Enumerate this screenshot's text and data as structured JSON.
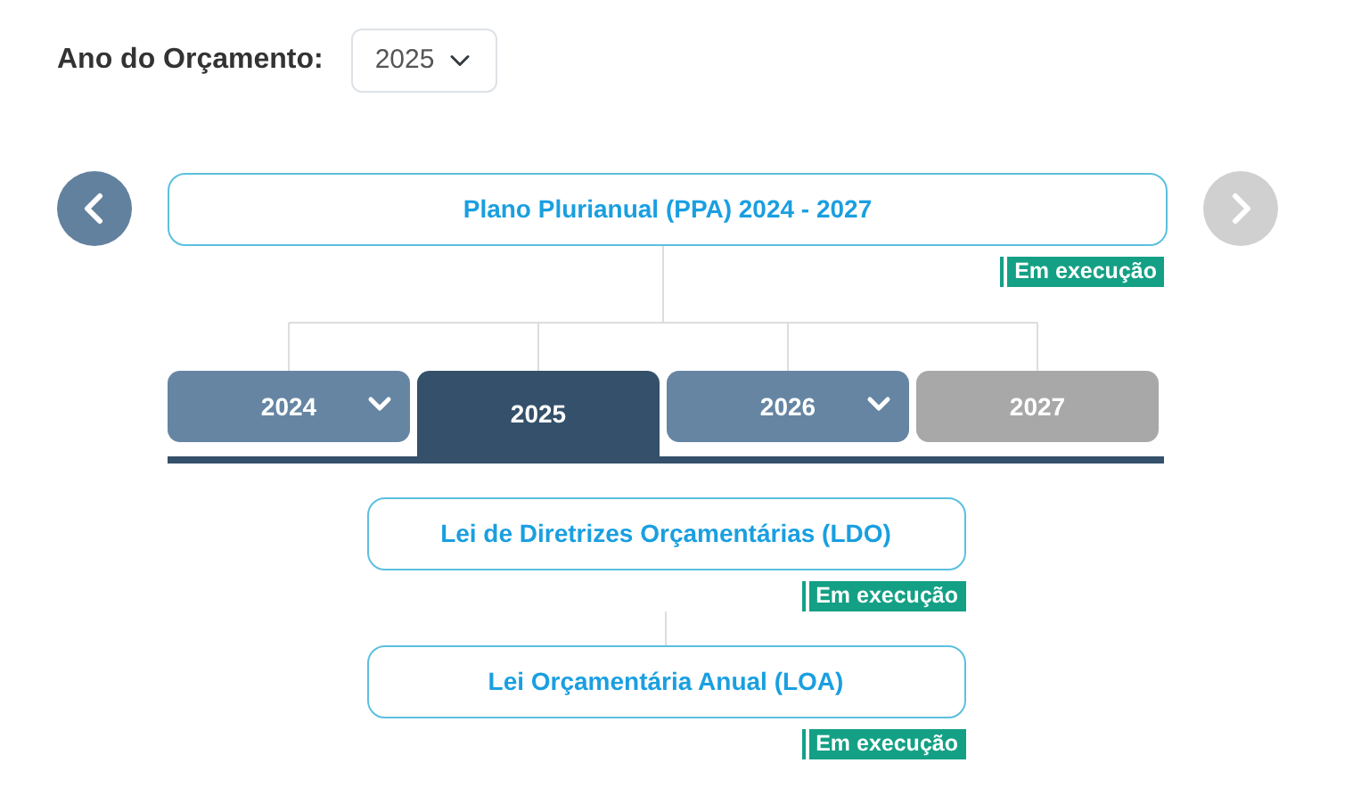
{
  "budget_year": {
    "label": "Ano do Orçamento:",
    "value": "2025"
  },
  "nav": {
    "previous": {
      "disabled": false
    },
    "next": {
      "disabled": true
    }
  },
  "ppa": {
    "title": "Plano Plurianual (PPA) 2024 - 2027",
    "status": "Em execução"
  },
  "years": [
    {
      "label": "2024",
      "selected": false,
      "disabled": false,
      "expandable": true
    },
    {
      "label": "2025",
      "selected": true,
      "disabled": false,
      "expandable": false
    },
    {
      "label": "2026",
      "selected": false,
      "disabled": false,
      "expandable": true
    },
    {
      "label": "2027",
      "selected": false,
      "disabled": true,
      "expandable": false
    }
  ],
  "laws": [
    {
      "title": "Lei de Diretrizes Orçamentárias (LDO)",
      "status": "Em execução"
    },
    {
      "title": "Lei Orçamentária Anual (LOA)",
      "status": "Em execução"
    }
  ]
}
